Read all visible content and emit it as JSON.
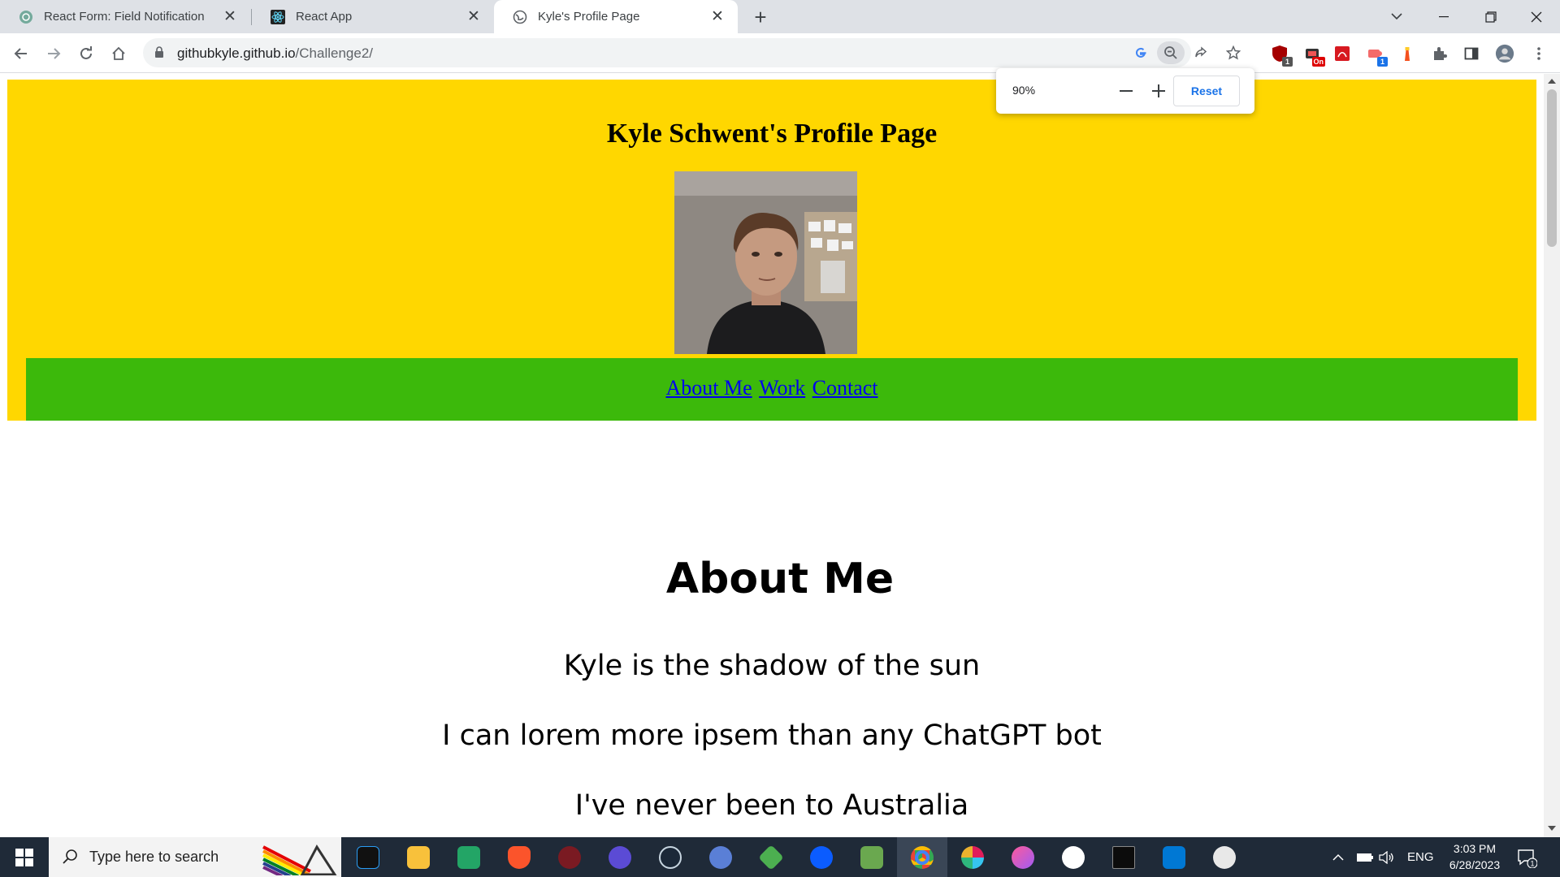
{
  "browser": {
    "tabs": [
      {
        "title": "React Form: Field Notification",
        "active": false
      },
      {
        "title": "React App",
        "active": false
      },
      {
        "title": "Kyle's Profile Page",
        "active": true
      }
    ],
    "url_host": "githubkyle.github.io",
    "url_path": "/Challenge2/",
    "zoom_popup": {
      "level": "90%",
      "minus": "—",
      "plus": "+",
      "reset": "Reset"
    },
    "extension_badges": {
      "ext1": "1",
      "ext2": "On",
      "ext3": "1"
    }
  },
  "page": {
    "title": "Kyle Schwent's Profile Page",
    "photo_alt": "Profile photo",
    "nav": [
      {
        "label": "About Me"
      },
      {
        "label": "Work"
      },
      {
        "label": "Contact"
      }
    ],
    "about": {
      "heading": "About Me",
      "lines": [
        "Kyle is the shadow of the sun",
        "I can lorem more ipsem than any ChatGPT bot",
        "I've never been to Australia"
      ]
    }
  },
  "taskbar": {
    "search_placeholder": "Type here to search",
    "language": "ENG",
    "time": "3:03 PM",
    "date": "6/28/2023",
    "notification_count": "1"
  },
  "colors": {
    "header_bg": "#ffd700",
    "nav_bg": "#3cb90b",
    "link": "#0000ee",
    "taskbar": "#1f2a38"
  }
}
